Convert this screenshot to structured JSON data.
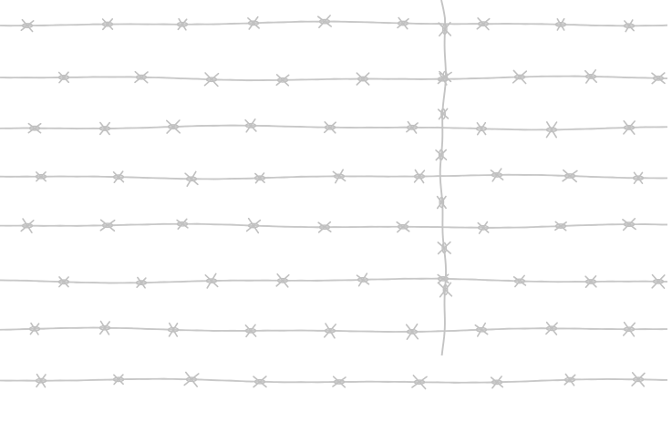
{
  "scene": {
    "background_color": "#ffffff",
    "wire_color": "#c8c8c8",
    "barb_color": "#c0c0c0",
    "post_color": "#c4c4c4",
    "horizontal_wire_count": 8,
    "vertical_wire_count": 1
  }
}
